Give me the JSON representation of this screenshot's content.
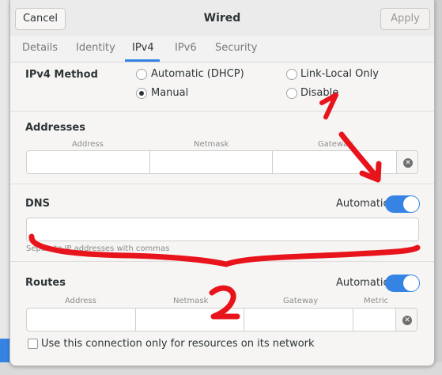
{
  "header": {
    "cancel": "Cancel",
    "title": "Wired",
    "apply": "Apply"
  },
  "tabs": [
    {
      "label": "Details",
      "active": false
    },
    {
      "label": "Identity",
      "active": false
    },
    {
      "label": "IPv4",
      "active": true
    },
    {
      "label": "IPv6",
      "active": false
    },
    {
      "label": "Security",
      "active": false
    }
  ],
  "ipv4_method": {
    "label": "IPv4 Method",
    "options": [
      {
        "label": "Automatic (DHCP)",
        "checked": false
      },
      {
        "label": "Link-Local Only",
        "checked": false
      },
      {
        "label": "Manual",
        "checked": true
      },
      {
        "label": "Disable",
        "checked": false
      }
    ]
  },
  "addresses": {
    "title": "Addresses",
    "columns": [
      "Address",
      "Netmask",
      "Gateway"
    ],
    "values": [
      "",
      "",
      ""
    ]
  },
  "dns": {
    "title": "DNS",
    "automatic_label": "Automatic",
    "automatic_on": true,
    "value": "",
    "hint": "Separate IP addresses with commas"
  },
  "routes": {
    "title": "Routes",
    "automatic_label": "Automatic",
    "automatic_on": true,
    "columns": [
      "Address",
      "Netmask",
      "Gateway",
      "Metric"
    ],
    "values": [
      "",
      "",
      "",
      ""
    ]
  },
  "restrict": {
    "label": "Use this connection only for resources on its network",
    "checked": false
  },
  "annotations": {
    "one": "1",
    "two": "2"
  },
  "colors": {
    "accent": "#3584e4",
    "annotation": "#e8141c"
  }
}
